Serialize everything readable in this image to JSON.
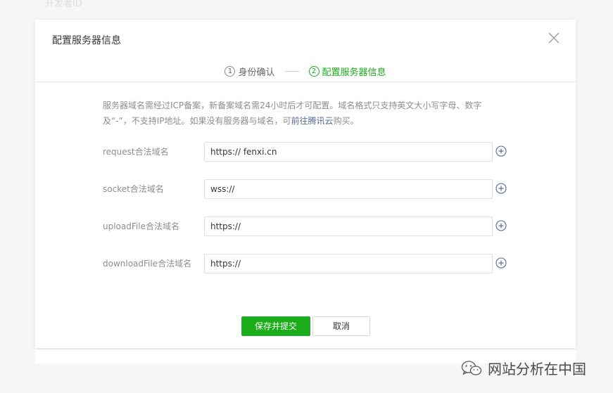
{
  "background": {
    "faded_text": "开发者ID"
  },
  "dialog": {
    "title": "配置服务器信息",
    "steps": [
      {
        "num": "1",
        "label": "身份确认",
        "active": false
      },
      {
        "num": "2",
        "label": "配置服务器信息",
        "active": true
      }
    ],
    "notice": {
      "text1": "服务器域名需经过ICP备案，新备案域名需24小时后才可配置。域名格式只支持英文大小写字母、数字及“-”，不支持IP地址。如果没有服务器与域名，可",
      "link": "前往腾讯云",
      "text2": "购买。"
    },
    "fields": [
      {
        "label": "request合法域名",
        "value": "https:// fenxi.cn"
      },
      {
        "label": "socket合法域名",
        "value": "wss://"
      },
      {
        "label": "uploadFile合法域名",
        "value": "https://"
      },
      {
        "label": "downloadFile合法域名",
        "value": "https://"
      }
    ],
    "buttons": {
      "submit": "保存并提交",
      "cancel": "取消"
    }
  },
  "watermark": {
    "text": "网站分析在中国"
  },
  "colors": {
    "accent": "#1aad19",
    "link": "#576b95",
    "muted_text": "#8d8d8d"
  }
}
